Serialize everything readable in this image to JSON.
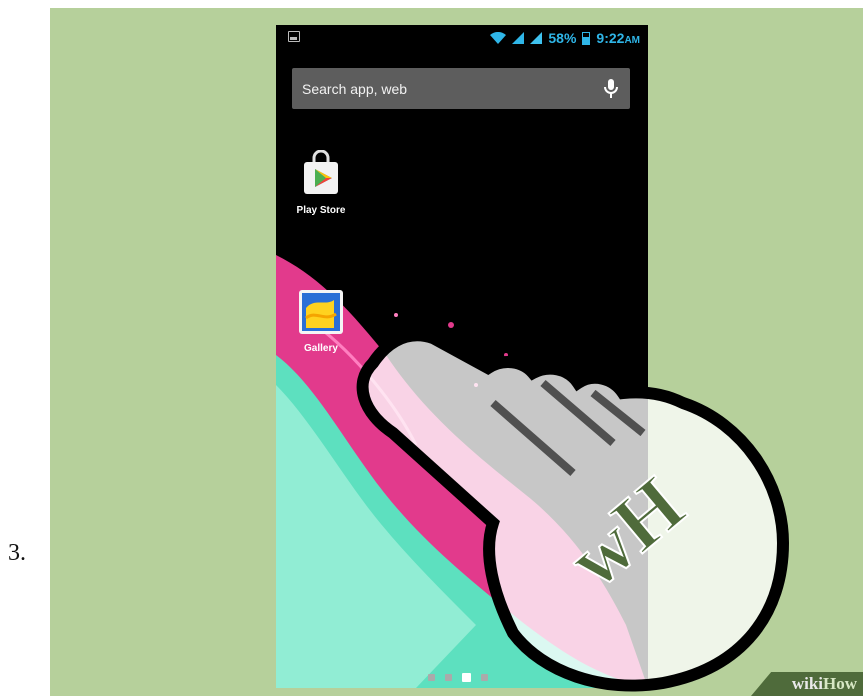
{
  "step": {
    "number": "3."
  },
  "status": {
    "battery": "58%",
    "time": "9:22",
    "ampm": "AM",
    "accent": "#2fb6e8"
  },
  "search": {
    "text": "Search app, web"
  },
  "apps": [
    {
      "label": "Play Store",
      "icon": "play-store-icon"
    },
    {
      "label": "Gallery",
      "icon": "gallery-icon"
    }
  ],
  "hand": {
    "logo": "wH"
  },
  "watermark": {
    "wiki": "wiki",
    "how": "How"
  },
  "colors": {
    "background": "#b6d09b",
    "logo": "#4f6b3b"
  }
}
